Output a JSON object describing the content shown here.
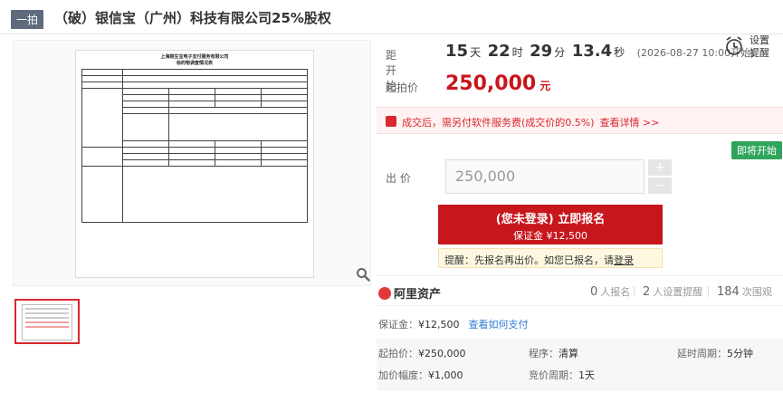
{
  "header": {
    "tag": "一拍",
    "title": "（破）银信宝（广州）科技有限公司25%股权"
  },
  "document": {
    "title_line1": "上海银生宝电子支付服务有限公司",
    "title_line2": "标的物调查情况表"
  },
  "countdown": {
    "label": "距开始",
    "days": "15",
    "days_unit": "天",
    "hours": "22",
    "hours_unit": "时",
    "minutes": "29",
    "minutes_unit": "分",
    "seconds": "13.4",
    "seconds_unit": "秒",
    "start_time": "(2026-08-27 10:00开始)"
  },
  "reminder": {
    "label": "设置提醒"
  },
  "start_price": {
    "label": "起拍价",
    "value": "250,000",
    "unit": "元"
  },
  "fee": {
    "text": "成交后，需另付软件服务费(成交价的0.5%)",
    "link": "查看详情 >>"
  },
  "bid_now_badge": "即将开始",
  "bid": {
    "label": "出  价",
    "value": "250,000",
    "plus": "+",
    "minus": "−"
  },
  "signup": {
    "line1": "(您未登录) 立即报名",
    "line2": "保证金 ¥12,500"
  },
  "tip": {
    "text": "提醒：先报名再出价。如您已报名，请",
    "login": "登录"
  },
  "stats": {
    "logo": "阿里资产",
    "signed_up_count": "0",
    "signed_up_label": "人报名",
    "reminder_count": "2",
    "reminder_label": "人设置提醒",
    "views_count": "184",
    "views_label": "次围观"
  },
  "meta": {
    "deposit_label": "保证金：",
    "deposit_value": "¥12,500",
    "deposit_link": "查看如何支付",
    "start_price_label": "起拍价：",
    "start_price_value": "¥250,000",
    "procedure_label": "程序：",
    "procedure_value": "清算",
    "delay_label": "延时周期：",
    "delay_value": "5分钟",
    "increment_label": "加价幅度：",
    "increment_value": "¥1,000",
    "period_label": "竞价周期：",
    "period_value": "1天"
  }
}
